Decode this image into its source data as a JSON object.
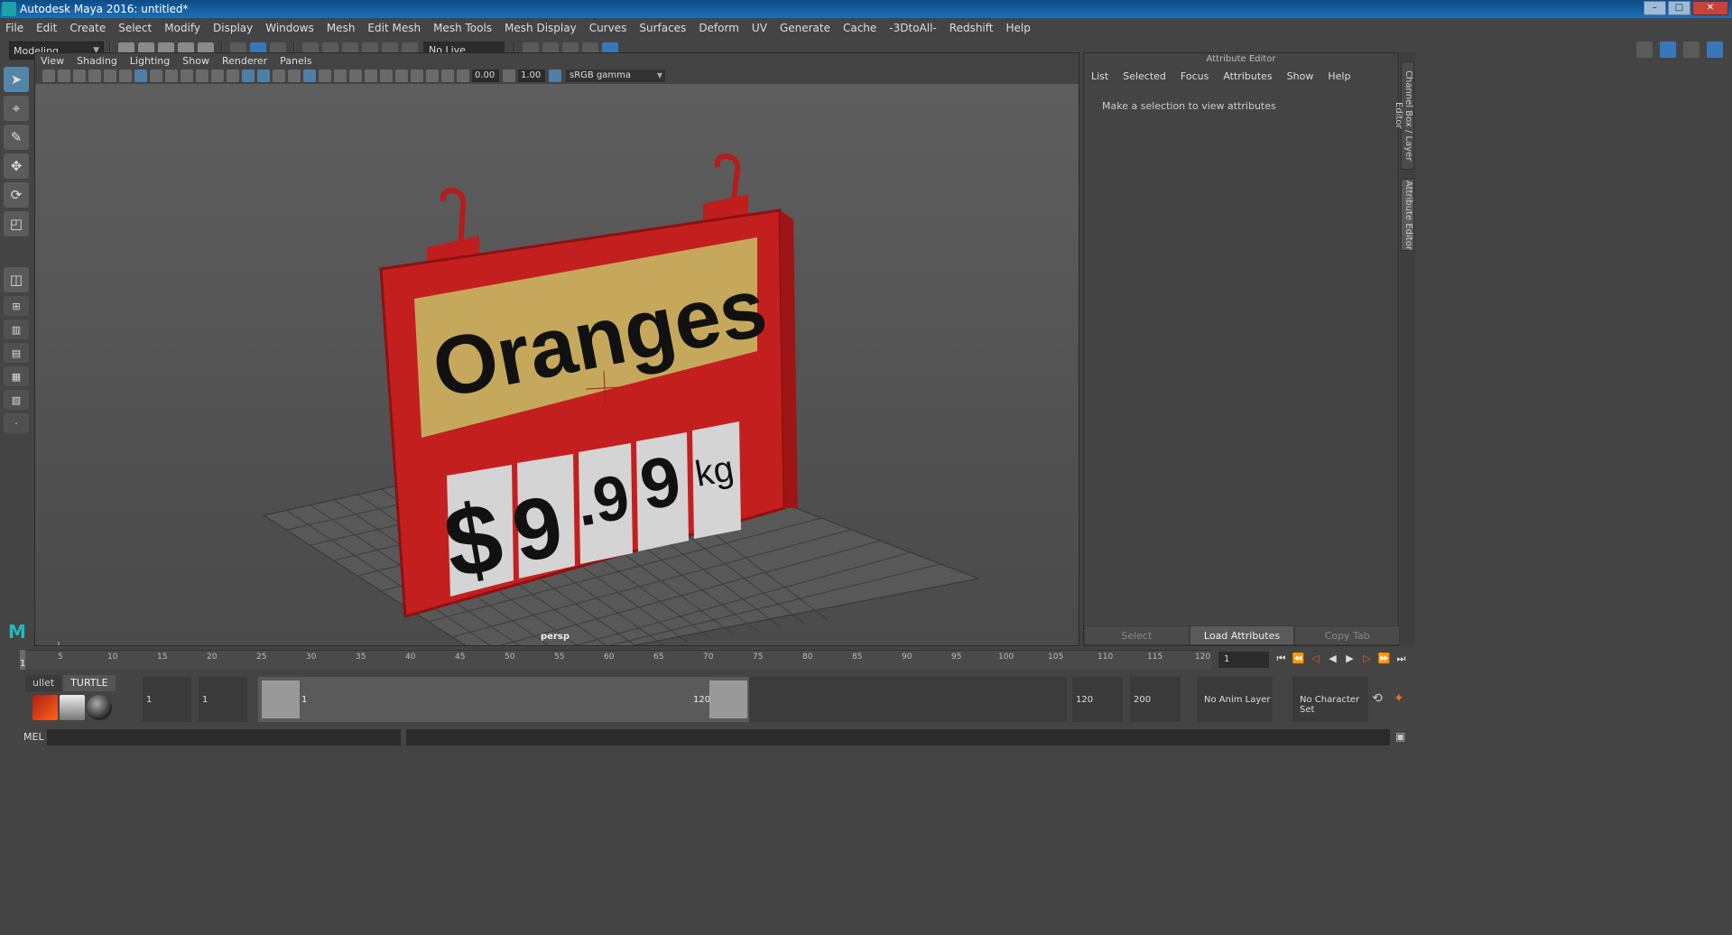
{
  "window": {
    "title": "Autodesk Maya 2016: untitled*",
    "minimize": "–",
    "maximize": "□",
    "close": "✕"
  },
  "menubar": [
    "File",
    "Edit",
    "Create",
    "Select",
    "Modify",
    "Display",
    "Windows",
    "Mesh",
    "Edit Mesh",
    "Mesh Tools",
    "Mesh Display",
    "Curves",
    "Surfaces",
    "Deform",
    "UV",
    "Generate",
    "Cache",
    "-3DtoAll-",
    "Redshift",
    "Help"
  ],
  "statusline": {
    "mode": "Modeling",
    "live_surface": "No Live Surface"
  },
  "viewport": {
    "menu": [
      "View",
      "Shading",
      "Lighting",
      "Show",
      "Renderer",
      "Panels"
    ],
    "field1": "0.00",
    "field2": "1.00",
    "color_space": "sRGB gamma",
    "camera": "persp",
    "sign_title": "Oranges",
    "price_chars": [
      "$",
      "9",
      ".9",
      "9",
      "kg"
    ]
  },
  "attribute_editor": {
    "header": "Attribute Editor",
    "menu": [
      "List",
      "Selected",
      "Focus",
      "Attributes",
      "Show",
      "Help"
    ],
    "message": "Make a selection to view attributes",
    "buttons": [
      "Select",
      "Load Attributes",
      "Copy Tab"
    ]
  },
  "side_tabs": {
    "channel_box": "Channel Box / Layer Editor",
    "attribute_editor": "Attribute Editor"
  },
  "timeslider": {
    "ticks": [
      "5",
      "10",
      "15",
      "20",
      "25",
      "30",
      "35",
      "40",
      "45",
      "50",
      "55",
      "60",
      "65",
      "70",
      "75",
      "80",
      "85",
      "90",
      "95",
      "100",
      "105",
      "110",
      "115",
      "120"
    ],
    "current_frame": "1",
    "frame_field": "1"
  },
  "rangebar": {
    "shelf_tabs": [
      "ullet",
      "TURTLE"
    ],
    "start_min": "1",
    "start": "1",
    "range_start_label": "1",
    "range_end_label": "120",
    "end": "120",
    "end_max": "200",
    "anim_layer": "No Anim Layer",
    "character_set": "No Character Set"
  },
  "cmdline": {
    "label": "MEL"
  }
}
